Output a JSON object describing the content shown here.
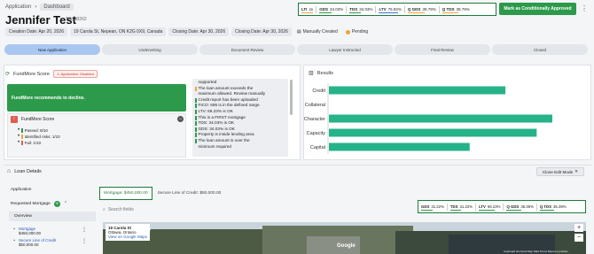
{
  "breadcrumb": {
    "parent": "Application",
    "current": "Dashboard"
  },
  "header": {
    "title": "Jennifer Test",
    "app_id": "TG100262",
    "approve_label": "Mark as Conditionally Approved"
  },
  "top_ratios": [
    {
      "label": "LTI",
      "value": "4x",
      "color": "#f0a33a",
      "fill": 0.95
    },
    {
      "label": "GDS",
      "value": "34.03%",
      "color": "#2c9a4a",
      "fill": 0.5
    },
    {
      "label": "TDS",
      "value": "34.03%",
      "color": "#2c9a4a",
      "fill": 0.5
    },
    {
      "label": "LTV",
      "value": "76.92%",
      "color": "#3b6fd8",
      "fill": 0.85
    },
    {
      "label": "Q GDS",
      "value": "39.79%",
      "color": "#f0a33a",
      "fill": 0.6
    },
    {
      "label": "Q TDS",
      "value": "39.79%",
      "color": "#f0a33a",
      "fill": 0.6
    }
  ],
  "info": {
    "creation": "Creation Date: Apr 20, 2026",
    "address": "19 Carola St, Nepean, ON K2G 0X9, Canada",
    "closing": "Closing Date: Apr 30, 2026",
    "closing2": "Closing Date: Apr 30, 2026",
    "manually": "Manually Created",
    "status": "Pending"
  },
  "stages": [
    "New Application",
    "Underwriting",
    "Document Review",
    "Lawyer Instructed",
    "Final Review",
    "Closed"
  ],
  "fundmore": {
    "title": "FundMore Score",
    "dismiss": "Application: Disabled",
    "recommend": "FundMore recommends to decline.",
    "score_title": "FundMore Score",
    "passed": "Passed: 8/10",
    "risks": "Identified risks: 1/10",
    "fail": "Fail: 1/10",
    "reasons": [
      {
        "text": "supported",
        "mark": "none"
      },
      {
        "text": "The loan amount exceeds the",
        "mark": "warn"
      },
      {
        "text": "maximum allowed.  Review manually",
        "mark": "none"
      },
      {
        "text": "Credit report has been uploaded",
        "mark": "ok"
      },
      {
        "text": "FICO: 695 is in the defined range",
        "mark": "ok"
      },
      {
        "text": "LTV: 69.23% is OK",
        "mark": "ok"
      },
      {
        "text": "This is a FIRST mortgage",
        "mark": "ok"
      },
      {
        "text": "TDS: 34.03% is OK",
        "mark": "ok"
      },
      {
        "text": "GDS: 34.03% is OK",
        "mark": "ok"
      },
      {
        "text": "Property is inside lending area",
        "mark": "ok"
      },
      {
        "text": "The loan amount is over the",
        "mark": "ok"
      },
      {
        "text": "minimum required",
        "mark": "none"
      }
    ]
  },
  "results": {
    "title": "Results",
    "colors": {
      "bar": "#26b38a"
    }
  },
  "chart_data": {
    "type": "bar",
    "orientation": "horizontal",
    "categories": [
      "Credit",
      "Collateral",
      "Character",
      "Capacity",
      "Capital"
    ],
    "values": [
      79,
      0,
      100,
      93,
      63
    ],
    "xlim": [
      0,
      100
    ],
    "title": "",
    "xlabel": "",
    "ylabel": ""
  },
  "loan_details": {
    "title": "Loan Details",
    "close_edit": "Close Edit Mode",
    "side_application": "Application",
    "side_requested": "Requested Mortgage",
    "side_overview": "Overview",
    "mortgage1_title": "Mortgage",
    "mortgage1_amount": "$450,000.00",
    "mortgage2_title": "Secure Line of Credit",
    "mortgage2_amount": "$50,000.00",
    "tab_mortgage": "Mortgage: $450,000.00",
    "tab_loc": "Secure Line of Credit: $50,000.00",
    "search_placeholder": "Search fields",
    "map_title": "19 Carola St",
    "map_sub": "Ottawa, Ontario",
    "map_link": "View on Google Maps",
    "map_brand": "Google",
    "map_footer": "Keyboard shortcuts  Map Data  Terms  Report a problem"
  },
  "bottom_ratios": [
    {
      "label": "GDS",
      "value": "31.22%",
      "color": "#2c9a4a",
      "fill": 0.5
    },
    {
      "label": "TDS",
      "value": "31.22%",
      "color": "#2c9a4a",
      "fill": 0.5
    },
    {
      "label": "LTV",
      "value": "69.23%",
      "color": "#2c9a4a",
      "fill": 0.75
    },
    {
      "label": "Q GDS",
      "value": "36.39%",
      "color": "#2c9a4a",
      "fill": 0.55
    },
    {
      "label": "Q TDS",
      "value": "36.39%",
      "color": "#2c9a4a",
      "fill": 0.55
    }
  ]
}
